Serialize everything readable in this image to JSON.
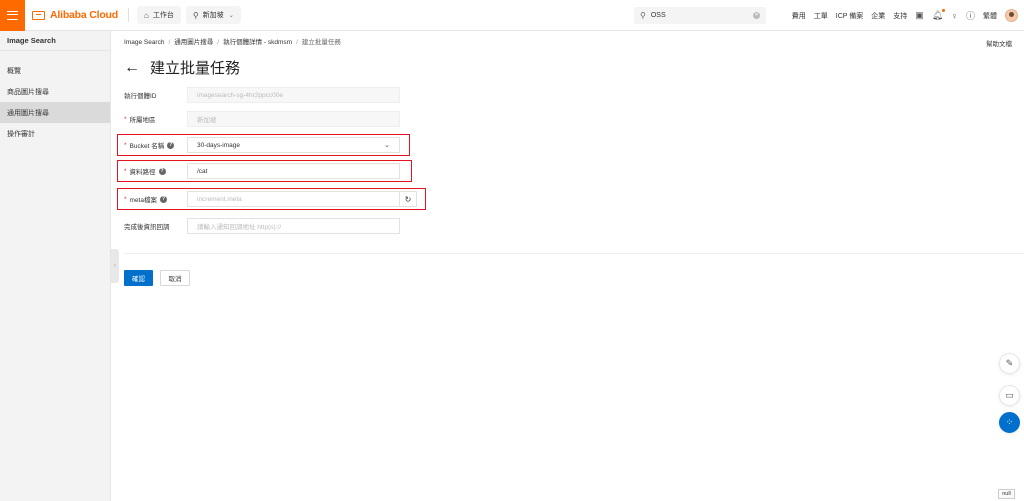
{
  "topbar": {
    "brand": "Alibaba Cloud",
    "workbench": "工作台",
    "region": "新加坡",
    "search_value": "OSS",
    "links": [
      "費用",
      "工單",
      "ICP 備案",
      "企業",
      "支持"
    ],
    "lang": "繁體"
  },
  "sidebar": {
    "title": "Image Search",
    "items": [
      {
        "label": "概覽"
      },
      {
        "label": "商品圖片搜尋"
      },
      {
        "label": "通用圖片搜尋"
      },
      {
        "label": "操作審計"
      }
    ]
  },
  "breadcrumb": {
    "items": [
      "Image Search",
      "通用圖片搜尋",
      "執行個體詳情 - skdmsm",
      "建立批量任務"
    ]
  },
  "help_link": "幫助文檔",
  "page": {
    "title": "建立批量任務"
  },
  "form": {
    "instance_id": {
      "label": "執行個體ID",
      "value": "imagesearch-sg-4hr2ppcc00e"
    },
    "region": {
      "label": "所屬地區",
      "value": "新加坡"
    },
    "bucket": {
      "label": "Bucket 名稱",
      "value": "30-days-image"
    },
    "data_path": {
      "label": "資料路徑",
      "value": "/cat"
    },
    "meta_file": {
      "label": "meta檔案",
      "placeholder": "increment.meta"
    },
    "callback": {
      "label": "完成後資訊回調",
      "placeholder": "請輸入通知回調地址 http(s)://"
    }
  },
  "actions": {
    "confirm": "確認",
    "cancel": "取消"
  },
  "null_tag": "null",
  "colors": {
    "brand": "#ff6a00",
    "primary": "#0070cc",
    "highlight": "#e4131e"
  }
}
